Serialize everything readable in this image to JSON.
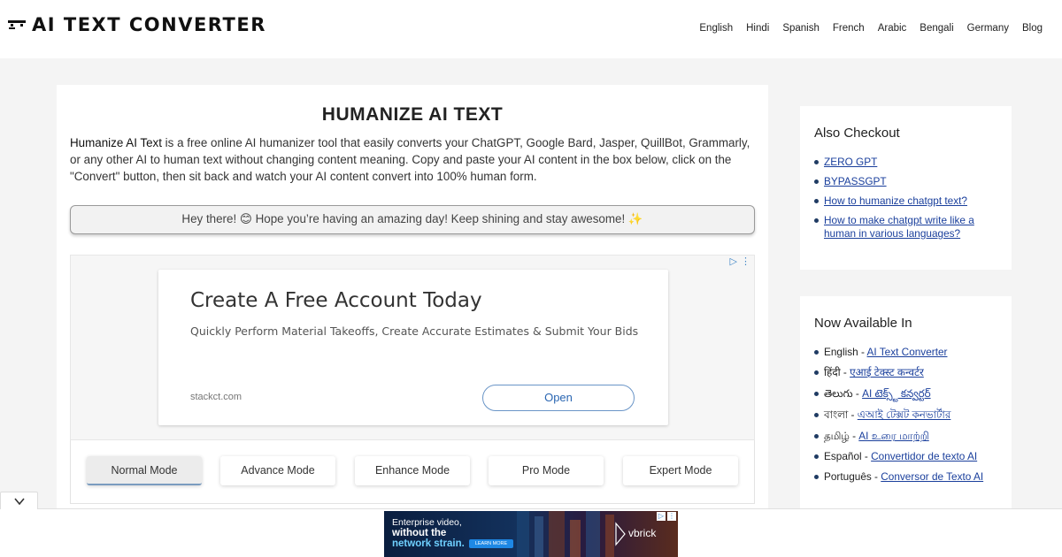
{
  "header": {
    "logo_text": "AI TEXT CONVERTER",
    "nav": [
      "English",
      "Hindi",
      "Spanish",
      "French",
      "Arabic",
      "Bengali",
      "Germany",
      "Blog"
    ]
  },
  "main": {
    "title": "HUMANIZE AI TEXT",
    "intro_bold": "Humanize AI Text",
    "intro_rest": " is a free online AI humanizer tool that easily converts your ChatGPT, Google Bard, Jasper, QuillBot, Grammarly, or any other AI to human text without changing content meaning. Copy and paste your AI content in the box below, click on the \"Convert\" button, then sit back and watch your AI content convert into 100% human form.",
    "greeting": "Hey there! 😊 Hope you’re having an amazing day! Keep shining and stay awesome! ✨",
    "ad": {
      "headline": "Create A Free Account Today",
      "subline": "Quickly Perform Material Takeoffs, Create Accurate Estimates & Submit Your Bids",
      "domain": "stackct.com",
      "button": "Open"
    },
    "modes": [
      {
        "label": "Normal Mode",
        "active": true
      },
      {
        "label": "Advance Mode",
        "active": false
      },
      {
        "label": "Enhance Mode",
        "active": false
      },
      {
        "label": "Pro Mode",
        "active": false
      },
      {
        "label": "Expert Mode",
        "active": false
      }
    ]
  },
  "sidebar": {
    "also": {
      "title": "Also Checkout",
      "links": [
        "ZERO GPT",
        "BYPASSGPT",
        "How to humanize chatgpt text?",
        "How to make chatgpt write like a human in various languages?"
      ]
    },
    "available": {
      "title": "Now Available In",
      "items": [
        {
          "lang": "English",
          "link": "AI Text Converter"
        },
        {
          "lang": "हिंदी",
          "link": "एआई टेक्स्ट कन्वर्टर"
        },
        {
          "lang": "తెలుగు",
          "link": "AI టెక్స్ట్ కన్వర్టర్"
        },
        {
          "lang": "বাংলা",
          "link": "এআই টেক্সট কনভার্টার"
        },
        {
          "lang": "தமிழ்",
          "link": "AI உரை மாற்றி"
        },
        {
          "lang": "Español",
          "link": "Convertidor de texto AI"
        },
        {
          "lang": "Português",
          "link": "Conversor de Texto AI"
        }
      ]
    }
  },
  "bottom_ad": {
    "line1": "Enterprise video,",
    "line2": "without the",
    "line3": "network strain.",
    "button": "LEARN MORE",
    "brand": "vbrick"
  },
  "icons": {
    "logo": "robot-face-icon",
    "collapse": "chevron-down-icon",
    "adchoices": "adchoices-icon",
    "ad_menu": "vertical-dots-icon"
  }
}
